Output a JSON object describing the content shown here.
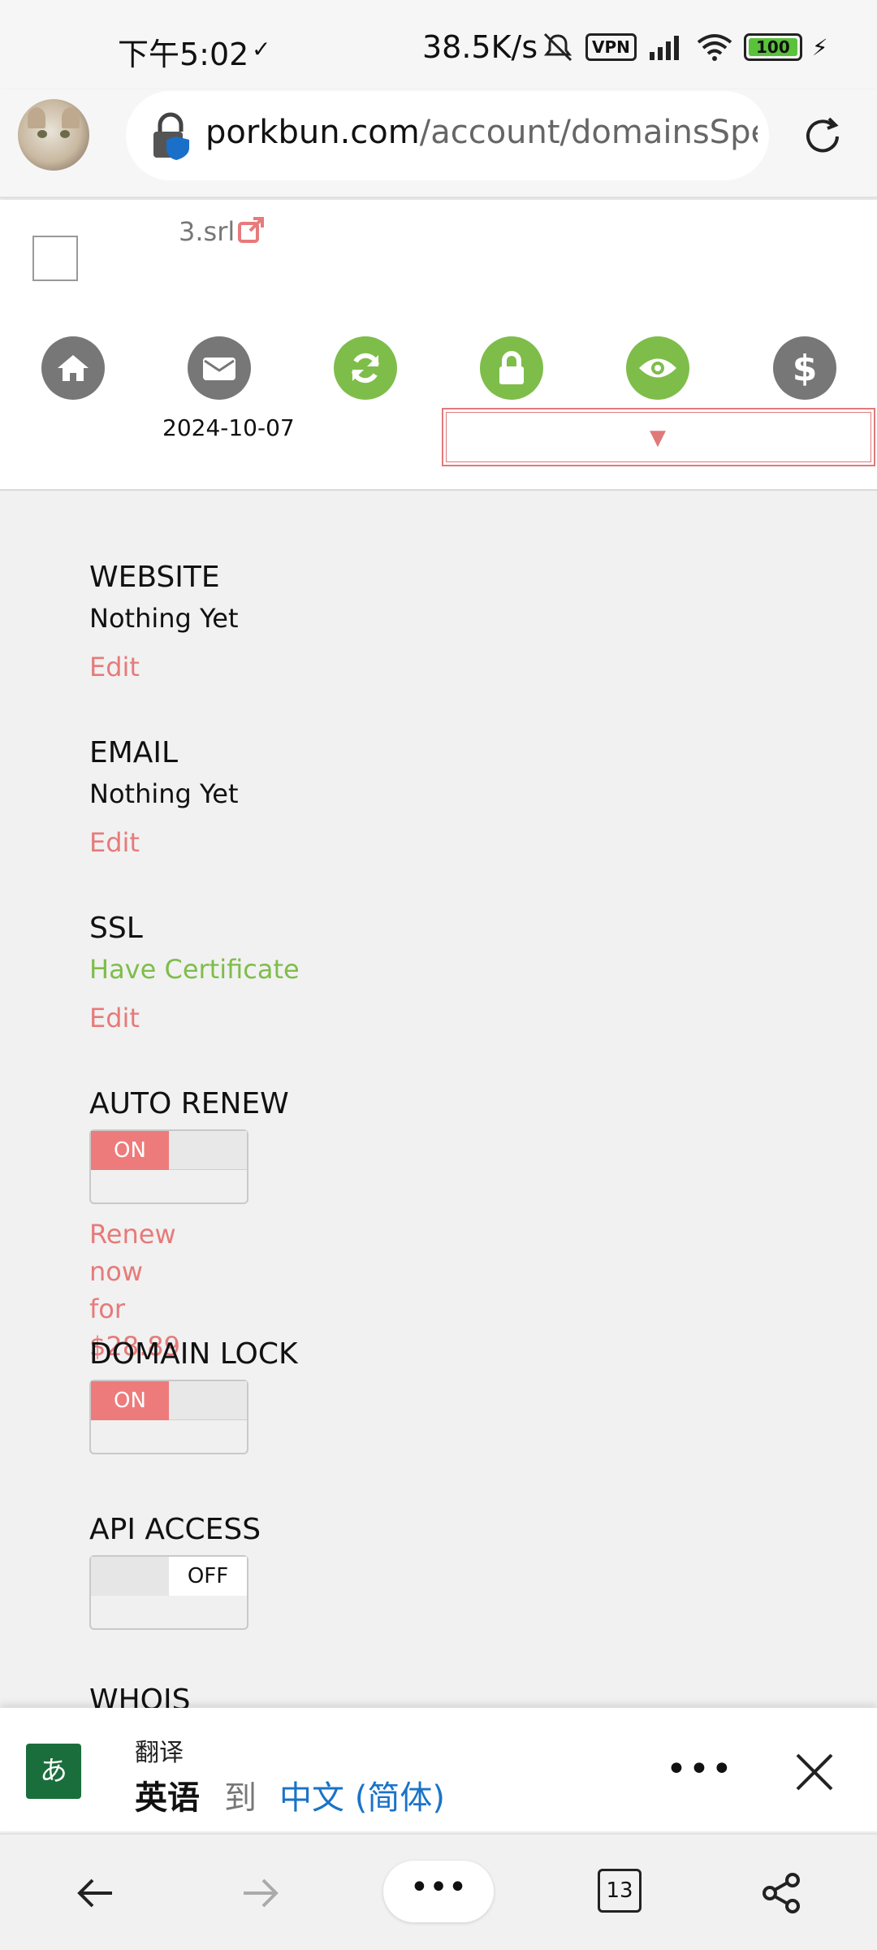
{
  "status_bar": {
    "time": "下午5:02",
    "network_speed": "38.5K/s",
    "vpn": "VPN",
    "battery": "100"
  },
  "browser": {
    "url_host": "porkbun.com",
    "url_path": "/account/domainsSpeedy"
  },
  "domain": {
    "name": "3.srl",
    "date": "2024-10-07",
    "action_icons": [
      "home-icon",
      "mail-icon",
      "renew-icon",
      "lock-icon",
      "eye-icon",
      "dollar-icon"
    ],
    "dropdown_value": "",
    "colors": {
      "accent": "#e77a7a",
      "green": "#7ebd4a",
      "gray": "#777777"
    }
  },
  "settings": {
    "website": {
      "label": "WEBSITE",
      "value": "Nothing Yet",
      "edit": "Edit"
    },
    "email": {
      "label": "EMAIL",
      "value": "Nothing Yet",
      "edit": "Edit"
    },
    "ssl": {
      "label": "SSL",
      "value": "Have Certificate",
      "edit": "Edit"
    },
    "auto_renew": {
      "label": "AUTO RENEW",
      "state": "ON",
      "renew_line1": "Renew now",
      "renew_line2": "for $28.89"
    },
    "domain_lock": {
      "label": "DOMAIN LOCK",
      "state": "ON"
    },
    "api_access": {
      "label": "API ACCESS",
      "state": "OFF"
    },
    "whois": {
      "label": "WHOIS"
    }
  },
  "translate_bar": {
    "title": "翻译",
    "from": "英语",
    "to_word": "到",
    "target": "中文 (简体)",
    "more": "•••"
  },
  "bottom_nav": {
    "more": "•••",
    "tabs_count": "13"
  }
}
